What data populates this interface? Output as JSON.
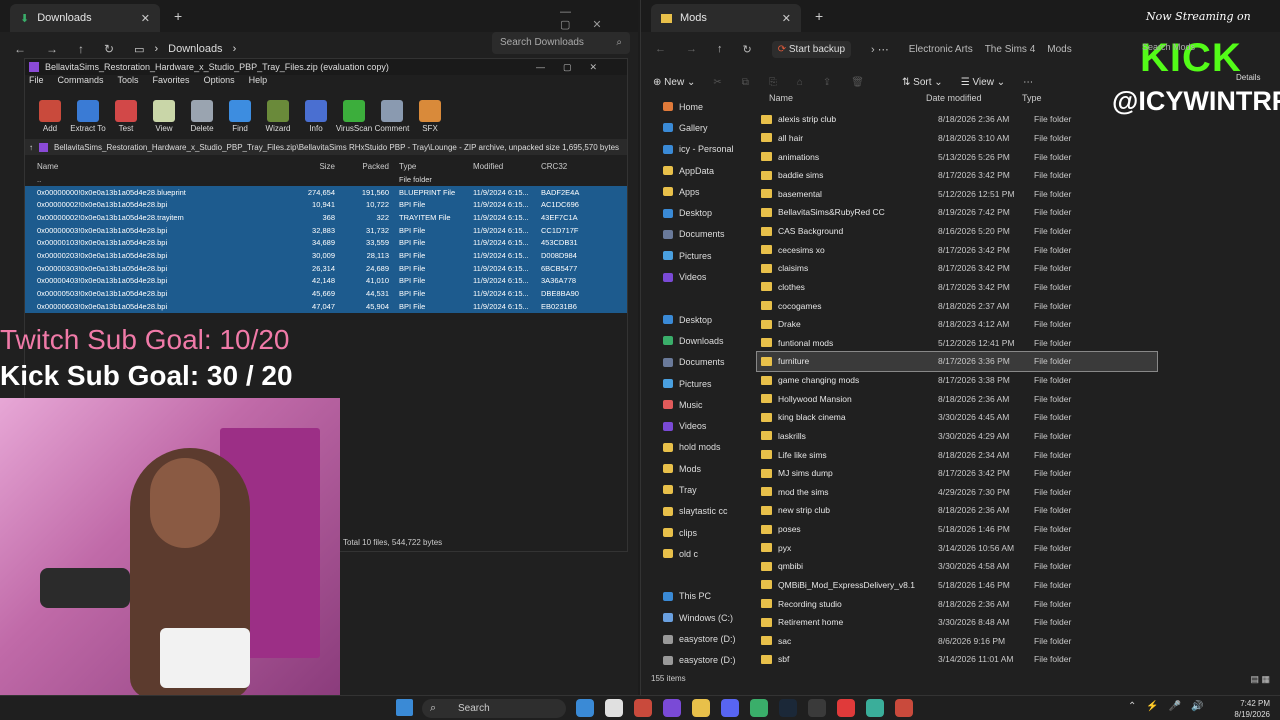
{
  "left_window": {
    "tab_title": "Downloads",
    "crumb": "Downloads",
    "search_placeholder": "Search Downloads"
  },
  "rar": {
    "title": "BellavitaSims_Restoration_Hardware_x_Studio_PBP_Tray_Files.zip (evaluation copy)",
    "menu": [
      "File",
      "Commands",
      "Tools",
      "Favorites",
      "Options",
      "Help"
    ],
    "tools": [
      {
        "label": "Add",
        "color": "#c94a3c"
      },
      {
        "label": "Extract To",
        "color": "#3a7bd5"
      },
      {
        "label": "Test",
        "color": "#d24848"
      },
      {
        "label": "View",
        "color": "#c9d6a8"
      },
      {
        "label": "Delete",
        "color": "#9aa4b0"
      },
      {
        "label": "Find",
        "color": "#3d8de0"
      },
      {
        "label": "Wizard",
        "color": "#6a8a3a"
      },
      {
        "label": "Info",
        "color": "#4a6fd1"
      },
      {
        "label": "VirusScan",
        "color": "#3cae3c"
      },
      {
        "label": "Comment",
        "color": "#8a9ab0"
      },
      {
        "label": "SFX",
        "color": "#d98a3a"
      }
    ],
    "path": "BellavitaSims_Restoration_Hardware_x_Studio_PBP_Tray_Files.zip\\BellavitaSims RHxStuido PBP - Tray\\Lounge - ZIP archive, unpacked size 1,695,570 bytes",
    "headers": {
      "name": "Name",
      "size": "Size",
      "packed": "Packed",
      "type": "Type",
      "modified": "Modified",
      "crc": "CRC32"
    },
    "up_row": {
      "name": "..",
      "type": "File folder"
    },
    "rows": [
      {
        "name": "0x00000000!0x0e0a13b1a05d4e28.blueprint",
        "size": "274,654",
        "packed": "191,560",
        "type": "BLUEPRINT File",
        "modified": "11/9/2024 6:15...",
        "crc": "BADF2E4A"
      },
      {
        "name": "0x00000002!0x0e0a13b1a05d4e28.bpi",
        "size": "10,941",
        "packed": "10,722",
        "type": "BPI File",
        "modified": "11/9/2024 6:15...",
        "crc": "AC1DC696"
      },
      {
        "name": "0x00000002!0x0e0a13b1a05d4e28.trayitem",
        "size": "368",
        "packed": "322",
        "type": "TRAYITEM File",
        "modified": "11/9/2024 6:15...",
        "crc": "43EF7C1A"
      },
      {
        "name": "0x00000003!0x0e0a13b1a05d4e28.bpi",
        "size": "32,883",
        "packed": "31,732",
        "type": "BPI File",
        "modified": "11/9/2024 6:15...",
        "crc": "CC1D717F"
      },
      {
        "name": "0x00000103!0x0e0a13b1a05d4e28.bpi",
        "size": "34,689",
        "packed": "33,559",
        "type": "BPI File",
        "modified": "11/9/2024 6:15...",
        "crc": "453CDB31"
      },
      {
        "name": "0x00000203!0x0e0a13b1a05d4e28.bpi",
        "size": "30,009",
        "packed": "28,113",
        "type": "BPI File",
        "modified": "11/9/2024 6:15...",
        "crc": "D008D984"
      },
      {
        "name": "0x00000303!0x0e0a13b1a05d4e28.bpi",
        "size": "26,314",
        "packed": "24,689",
        "type": "BPI File",
        "modified": "11/9/2024 6:15...",
        "crc": "6BCB5477"
      },
      {
        "name": "0x00000403!0x0e0a13b1a05d4e28.bpi",
        "size": "42,148",
        "packed": "41,010",
        "type": "BPI File",
        "modified": "11/9/2024 6:15...",
        "crc": "3A36A778"
      },
      {
        "name": "0x00000503!0x0e0a13b1a05d4e28.bpi",
        "size": "45,669",
        "packed": "44,531",
        "type": "BPI File",
        "modified": "11/9/2024 6:15...",
        "crc": "DBE8BA90"
      },
      {
        "name": "0x00000603!0x0e0a13b1a05d4e28.bpi",
        "size": "47,047",
        "packed": "45,904",
        "type": "BPI File",
        "modified": "11/9/2024 6:15...",
        "crc": "EB0231B6"
      }
    ],
    "status": "Total 10 files, 544,722 bytes"
  },
  "overlay": {
    "twitch_goal": "Twitch Sub Goal: 10/20",
    "kick_goal": "Kick Sub Goal: 30 / 20",
    "now_streaming": "Now Streaming on",
    "kick_logo": "KICK",
    "handle": "@ICYWINTRR"
  },
  "right_window": {
    "tab_title": "Mods",
    "start_backup": "Start backup",
    "crumbs": [
      "Electronic Arts",
      "The Sims 4",
      "Mods"
    ],
    "search_placeholder": "Search Mods",
    "details": "Details",
    "cmd": {
      "new": "New",
      "sort": "Sort",
      "view": "View"
    },
    "columns": {
      "name": "Name",
      "date": "Date modified",
      "type": "Type"
    },
    "sidebar": [
      {
        "label": "Home",
        "color": "#e07a3a"
      },
      {
        "label": "Gallery",
        "color": "#3a8ad6"
      },
      {
        "label": "icy - Personal",
        "color": "#3a8ad6"
      },
      {
        "label": "AppData",
        "color": "#e8c04a"
      },
      {
        "label": "Apps",
        "color": "#e8c04a"
      },
      {
        "label": "Desktop",
        "color": "#3a8ad6"
      },
      {
        "label": "Documents",
        "color": "#6a7a9a"
      },
      {
        "label": "Pictures",
        "color": "#4aa0e0"
      },
      {
        "label": "Videos",
        "color": "#7a4ad6"
      },
      {
        "label": "",
        "color": ""
      },
      {
        "label": "Desktop",
        "color": "#3a8ad6"
      },
      {
        "label": "Downloads",
        "color": "#3aae6a"
      },
      {
        "label": "Documents",
        "color": "#6a7a9a"
      },
      {
        "label": "Pictures",
        "color": "#4aa0e0"
      },
      {
        "label": "Music",
        "color": "#e05a5a"
      },
      {
        "label": "Videos",
        "color": "#7a4ad6"
      },
      {
        "label": "hold mods",
        "color": "#e8c04a"
      },
      {
        "label": "Mods",
        "color": "#e8c04a"
      },
      {
        "label": "Tray",
        "color": "#e8c04a"
      },
      {
        "label": "slaytastic cc",
        "color": "#e8c04a"
      },
      {
        "label": "clips",
        "color": "#e8c04a"
      },
      {
        "label": "old c",
        "color": "#e8c04a"
      },
      {
        "label": "",
        "color": ""
      },
      {
        "label": "This PC",
        "color": "#3a8ad6"
      },
      {
        "label": "Windows (C:)",
        "color": "#6aa0e0"
      },
      {
        "label": "easystore (D:)",
        "color": "#999999"
      },
      {
        "label": "easystore (D:)",
        "color": "#999999"
      }
    ],
    "folders": [
      {
        "name": "alexis strip club",
        "date": "8/18/2026 2:36 AM",
        "type": "File folder"
      },
      {
        "name": "all hair",
        "date": "8/18/2026 3:10 AM",
        "type": "File folder"
      },
      {
        "name": "animations",
        "date": "5/13/2026 5:26 PM",
        "type": "File folder"
      },
      {
        "name": "baddie sims",
        "date": "8/17/2026 3:42 PM",
        "type": "File folder"
      },
      {
        "name": "basemental",
        "date": "5/12/2026 12:51 PM",
        "type": "File folder"
      },
      {
        "name": "BellavitaSims&RubyRed CC",
        "date": "8/19/2026 7:42 PM",
        "type": "File folder"
      },
      {
        "name": "CAS Background",
        "date": "8/16/2026 5:20 PM",
        "type": "File folder"
      },
      {
        "name": "cecesims xo",
        "date": "8/17/2026 3:42 PM",
        "type": "File folder"
      },
      {
        "name": "claisims",
        "date": "8/17/2026 3:42 PM",
        "type": "File folder"
      },
      {
        "name": "clothes",
        "date": "8/17/2026 3:42 PM",
        "type": "File folder"
      },
      {
        "name": "cocogames",
        "date": "8/18/2026 2:37 AM",
        "type": "File folder"
      },
      {
        "name": "Drake",
        "date": "8/18/2023 4:12 AM",
        "type": "File folder"
      },
      {
        "name": "funtional mods",
        "date": "5/12/2026 12:41 PM",
        "type": "File folder"
      },
      {
        "name": "furniture",
        "date": "8/17/2026 3:36 PM",
        "type": "File folder"
      },
      {
        "name": "game changing mods",
        "date": "8/17/2026 3:38 PM",
        "type": "File folder"
      },
      {
        "name": "Hollywood Mansion",
        "date": "8/18/2026 2:36 AM",
        "type": "File folder"
      },
      {
        "name": "king black cinema",
        "date": "3/30/2026 4:45 AM",
        "type": "File folder"
      },
      {
        "name": "laskrills",
        "date": "3/30/2026 4:29 AM",
        "type": "File folder"
      },
      {
        "name": "Life like sims",
        "date": "8/18/2026 2:34 AM",
        "type": "File folder"
      },
      {
        "name": "MJ sims dump",
        "date": "8/17/2026 3:42 PM",
        "type": "File folder"
      },
      {
        "name": "mod the sims",
        "date": "4/29/2026 7:30 PM",
        "type": "File folder"
      },
      {
        "name": "new strip club",
        "date": "8/18/2026 2:36 AM",
        "type": "File folder"
      },
      {
        "name": "poses",
        "date": "5/18/2026 1:46 PM",
        "type": "File folder"
      },
      {
        "name": "pyx",
        "date": "3/14/2026 10:56 AM",
        "type": "File folder"
      },
      {
        "name": "qmbibi",
        "date": "3/30/2026 4:58 AM",
        "type": "File folder"
      },
      {
        "name": "QMBiBi_Mod_ExpressDelivery_v8.1",
        "date": "5/18/2026 1:46 PM",
        "type": "File folder"
      },
      {
        "name": "Recording studio",
        "date": "8/18/2026 2:36 AM",
        "type": "File folder"
      },
      {
        "name": "Retirement home",
        "date": "3/30/2026 8:48 AM",
        "type": "File folder"
      },
      {
        "name": "sac",
        "date": "8/6/2026 9:16 PM",
        "type": "File folder"
      },
      {
        "name": "sbf",
        "date": "3/14/2026 11:01 AM",
        "type": "File folder"
      }
    ],
    "selected_index": 13,
    "status": "155 items"
  },
  "taskbar": {
    "search": "Search",
    "time": "7:42 PM",
    "date": "8/19/2026",
    "apps": [
      "#3a8ad6",
      "#e0e0e0",
      "#c94a3c",
      "#7a4ad6",
      "#e8c04a",
      "#5865f2",
      "#3aae6a",
      "#1b2838",
      "#3a3a3a",
      "#e03a3a",
      "#3aae9a",
      "#c94a3c"
    ]
  }
}
